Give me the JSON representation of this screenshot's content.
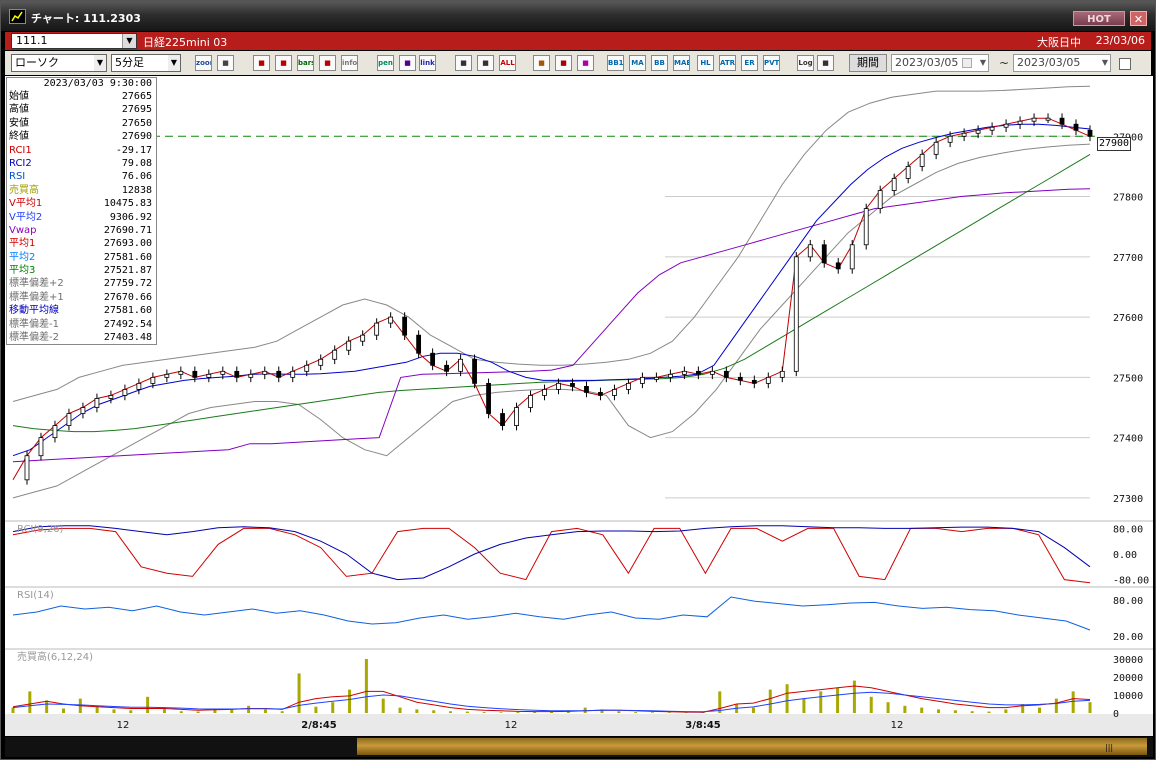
{
  "window": {
    "title": "チャート: 111.2303",
    "hot_label": "HOT",
    "close_label": "✕"
  },
  "symbol_bar": {
    "code": "111.1",
    "name": "日経225mini 03",
    "market": "大阪日中",
    "date": "23/03/06"
  },
  "toolbar": {
    "chart_type": "ローソク",
    "interval": "5分足",
    "buttons": [
      "zoom",
      "cursor",
      "trade",
      "order",
      "bars",
      "alert",
      "info",
      "pen",
      "arrow",
      "link",
      "candle1",
      "candle2",
      "ALL",
      "settings",
      "wrench",
      "palette",
      "BB1",
      "MA",
      "BB",
      "MAE",
      "HL",
      "ATR",
      "ER",
      "PVT",
      "Log",
      "export"
    ],
    "period_label": "期間",
    "date_from": "2023/03/05",
    "tilde": "~",
    "date_to": "2023/03/05"
  },
  "info_panel": {
    "datetime": "2023/03/03 9:30:00",
    "rows": [
      {
        "label": "始値",
        "value": "27665",
        "color": "#000000"
      },
      {
        "label": "高値",
        "value": "27695",
        "color": "#000000"
      },
      {
        "label": "安値",
        "value": "27650",
        "color": "#000000"
      },
      {
        "label": "終値",
        "value": "27690",
        "color": "#000000"
      },
      {
        "label": "RCI1",
        "value": "-29.17",
        "color": "#d00000"
      },
      {
        "label": "RCI2",
        "value": "79.08",
        "color": "#0000c0"
      },
      {
        "label": "RSI",
        "value": "76.06",
        "color": "#0050d0"
      },
      {
        "label": "売買高",
        "value": "12838",
        "color": "#a0a000"
      },
      {
        "label": "V平均1",
        "value": "10475.83",
        "color": "#d00000"
      },
      {
        "label": "V平均2",
        "value": "9306.92",
        "color": "#2040ff"
      },
      {
        "label": "Vwap",
        "value": "27690.71",
        "color": "#9000c0"
      },
      {
        "label": "平均1",
        "value": "27693.00",
        "color": "#d00000"
      },
      {
        "label": "平均2",
        "value": "27581.60",
        "color": "#0080ff"
      },
      {
        "label": "平均3",
        "value": "27521.87",
        "color": "#008000"
      },
      {
        "label": "標準偏差+2",
        "value": "27759.72",
        "color": "#707070"
      },
      {
        "label": "標準偏差+1",
        "value": "27670.66",
        "color": "#707070"
      },
      {
        "label": "移動平均線",
        "value": "27581.60",
        "color": "#0000c0"
      },
      {
        "label": "標準偏差-1",
        "value": "27492.54",
        "color": "#707070"
      },
      {
        "label": "標準偏差-2",
        "value": "27403.48",
        "color": "#707070"
      }
    ]
  },
  "price_marker": "27900",
  "chart_data": {
    "type": "line",
    "title": "",
    "price_axis": {
      "ticks": [
        27300,
        27400,
        27500,
        27600,
        27700,
        27800,
        27900
      ],
      "ylim": [
        27265,
        28000
      ]
    },
    "x_tick_labels": [
      "12",
      "2/8:45",
      "12",
      "3/8:45",
      "12"
    ],
    "current_price": 27900,
    "close_series": [
      27330,
      27370,
      27400,
      27420,
      27440,
      27450,
      27465,
      27470,
      27480,
      27490,
      27500,
      27505,
      27510,
      27500,
      27505,
      27510,
      27500,
      27505,
      27510,
      27500,
      27510,
      27520,
      27530,
      27545,
      27560,
      27570,
      27590,
      27600,
      27570,
      27540,
      27520,
      27510,
      27530,
      27490,
      27440,
      27420,
      27450,
      27470,
      27480,
      27490,
      27485,
      27475,
      27470,
      27480,
      27490,
      27500,
      27500,
      27505,
      27510,
      27505,
      27510,
      27500,
      27495,
      27490,
      27500,
      27510,
      27700,
      27720,
      27690,
      27680,
      27720,
      27780,
      27810,
      27830,
      27850,
      27870,
      27890,
      27900,
      27905,
      27910,
      27915,
      27920,
      27925,
      27930,
      27930,
      27920,
      27910,
      27900
    ],
    "indicators": {
      "rci": {
        "label": "RCI(9,26)",
        "ticks": [
          "80.00",
          "0.00",
          "-80.00"
        ],
        "ylim": [
          -100,
          100
        ],
        "rci1": [
          60,
          75,
          80,
          80,
          70,
          -40,
          -60,
          -70,
          30,
          80,
          80,
          60,
          20,
          -70,
          -60,
          70,
          80,
          80,
          20,
          -60,
          -80,
          70,
          80,
          60,
          -60,
          80,
          80,
          -60,
          80,
          80,
          40,
          80,
          80,
          -70,
          -80,
          80,
          80,
          70,
          80,
          80,
          60,
          -80,
          -90
        ],
        "rci2": [
          70,
          85,
          88,
          88,
          80,
          70,
          60,
          70,
          82,
          85,
          82,
          70,
          40,
          0,
          -60,
          -80,
          -75,
          -40,
          0,
          30,
          50,
          60,
          70,
          72,
          72,
          70,
          72,
          80,
          85,
          88,
          88,
          85,
          82,
          82,
          80,
          80,
          82,
          84,
          84,
          80,
          70,
          20,
          -40
        ]
      },
      "rsi": {
        "label": "RSI(14)",
        "ticks": [
          "80.00",
          "20.00"
        ],
        "ylim": [
          0,
          100
        ],
        "values": [
          55,
          60,
          70,
          65,
          68,
          62,
          70,
          60,
          55,
          60,
          65,
          58,
          62,
          55,
          45,
          40,
          42,
          50,
          55,
          48,
          52,
          58,
          52,
          48,
          55,
          60,
          50,
          48,
          55,
          52,
          85,
          78,
          74,
          70,
          72,
          75,
          76,
          70,
          66,
          68,
          64,
          62,
          55,
          50,
          45,
          30
        ]
      },
      "volume": {
        "label": "売買高(6,12,24)",
        "ticks": [
          "30000",
          "20000",
          "10000",
          "0"
        ],
        "ylim": [
          0,
          35000
        ],
        "values": [
          3000,
          12000,
          7000,
          2500,
          8000,
          4000,
          2000,
          1500,
          9000,
          3000,
          1000,
          800,
          2500,
          1800,
          4000,
          2000,
          1000,
          22000,
          3500,
          6000,
          13000,
          30000,
          8000,
          3000,
          2000,
          1500,
          1000,
          800,
          500,
          400,
          500,
          800,
          600,
          1500,
          3000,
          2000,
          1000,
          500,
          400,
          300,
          200,
          600,
          12000,
          5000,
          3000,
          13000,
          16000,
          8000,
          12000,
          14000,
          18000,
          9000,
          6000,
          4000,
          3000,
          2000,
          1500,
          1000,
          800,
          2000,
          5000,
          3000,
          8000,
          12000,
          6000
        ],
        "v1": [
          3500,
          5000,
          6500,
          5000,
          4000,
          3500,
          3000,
          2500,
          2500,
          2500,
          2000,
          1500,
          1800,
          2000,
          2500,
          2500,
          2000,
          6000,
          8000,
          9000,
          9500,
          12000,
          12000,
          9000,
          6000,
          4500,
          3000,
          2000,
          1500,
          1200,
          900,
          800,
          800,
          900,
          1300,
          1600,
          1500,
          1200,
          900,
          700,
          500,
          400,
          2500,
          5000,
          5500,
          8000,
          11000,
          12000,
          13000,
          14000,
          15000,
          14000,
          12000,
          10000,
          8000,
          6500,
          5000,
          4000,
          3000,
          3000,
          4000,
          4500,
          5500,
          8000,
          7500
        ],
        "v2": [
          3000,
          4000,
          5000,
          4800,
          4500,
          4000,
          3600,
          3200,
          3200,
          3000,
          2700,
          2300,
          2200,
          2200,
          2400,
          2400,
          2200,
          4200,
          5500,
          6500,
          7500,
          9000,
          10000,
          9500,
          8000,
          6500,
          5000,
          3800,
          3000,
          2400,
          1900,
          1500,
          1300,
          1200,
          1300,
          1500,
          1500,
          1400,
          1200,
          1000,
          800,
          700,
          1400,
          2600,
          3400,
          5000,
          6800,
          8000,
          9000,
          10000,
          11000,
          11500,
          11000,
          10000,
          9000,
          8000,
          7000,
          6000,
          5000,
          4500,
          4500,
          4800,
          5300,
          6500,
          7000
        ]
      }
    },
    "overlay_series": {
      "sma_blue": [
        27370,
        27380,
        27400,
        27420,
        27440,
        27455,
        27465,
        27475,
        27485,
        27490,
        27495,
        27498,
        27500,
        27502,
        27505,
        27506,
        27505,
        27505,
        27506,
        27508,
        27510,
        27515,
        27520,
        27525,
        27535,
        27540,
        27540,
        27535,
        27525,
        27510,
        27500,
        27495,
        27495,
        27495,
        27495,
        27496,
        27497,
        27498,
        27500,
        27502,
        27505,
        27520,
        27560,
        27600,
        27640,
        27680,
        27720,
        27760,
        27790,
        27820,
        27845,
        27865,
        27880,
        27890,
        27898,
        27905,
        27910,
        27915,
        27918,
        27920,
        27920,
        27918,
        27915,
        27912
      ],
      "ma_green": [
        27420,
        27415,
        27412,
        27410,
        27410,
        27412,
        27415,
        27420,
        27425,
        27430,
        27435,
        27440,
        27445,
        27450,
        27455,
        27460,
        27465,
        27470,
        27475,
        27478,
        27480,
        27482,
        27484,
        27486,
        27488,
        27490,
        27492,
        27493,
        27494,
        27495,
        27496,
        27497,
        27498,
        27500,
        27505,
        27515,
        27530,
        27550,
        27570,
        27590,
        27610,
        27630,
        27650,
        27670,
        27690,
        27710,
        27730,
        27750,
        27770,
        27790,
        27810,
        27830,
        27850,
        27870
      ],
      "vwap_purple": [
        27360,
        27362,
        27364,
        27366,
        27368,
        27370,
        27372,
        27374,
        27376,
        27378,
        27380,
        27390,
        27390,
        27392,
        27394,
        27396,
        27398,
        27400,
        27500,
        27505,
        27506,
        27507,
        27508,
        27509,
        27510,
        27512,
        27520,
        27560,
        27600,
        27640,
        27670,
        27690,
        27700,
        27710,
        27720,
        27730,
        27740,
        27750,
        27760,
        27770,
        27780,
        27785,
        27790,
        27795,
        27800,
        27803,
        27806,
        27808,
        27810,
        27812,
        27813
      ],
      "bb_upper": [
        27460,
        27470,
        27480,
        27500,
        27510,
        27520,
        27525,
        27530,
        27535,
        27540,
        27545,
        27550,
        27560,
        27580,
        27600,
        27620,
        27630,
        27620,
        27600,
        27570,
        27550,
        27530,
        27525,
        27522,
        27520,
        27520,
        27522,
        27525,
        27530,
        27540,
        27560,
        27600,
        27650,
        27700,
        27760,
        27820,
        27870,
        27910,
        27940,
        27955,
        27965,
        27970,
        27975,
        27975,
        27975,
        27976,
        27978,
        27980,
        27982,
        27983
      ],
      "bb_lower": [
        27300,
        27310,
        27320,
        27340,
        27360,
        27380,
        27400,
        27420,
        27440,
        27450,
        27455,
        27460,
        27460,
        27455,
        27430,
        27400,
        27380,
        27370,
        27400,
        27430,
        27460,
        27470,
        27475,
        27478,
        27480,
        27480,
        27478,
        27470,
        27420,
        27400,
        27410,
        27440,
        27480,
        27530,
        27580,
        27620,
        27660,
        27700,
        27740,
        27770,
        27800,
        27820,
        27840,
        27855,
        27865,
        27872,
        27878,
        27882,
        27885,
        27887
      ]
    }
  }
}
